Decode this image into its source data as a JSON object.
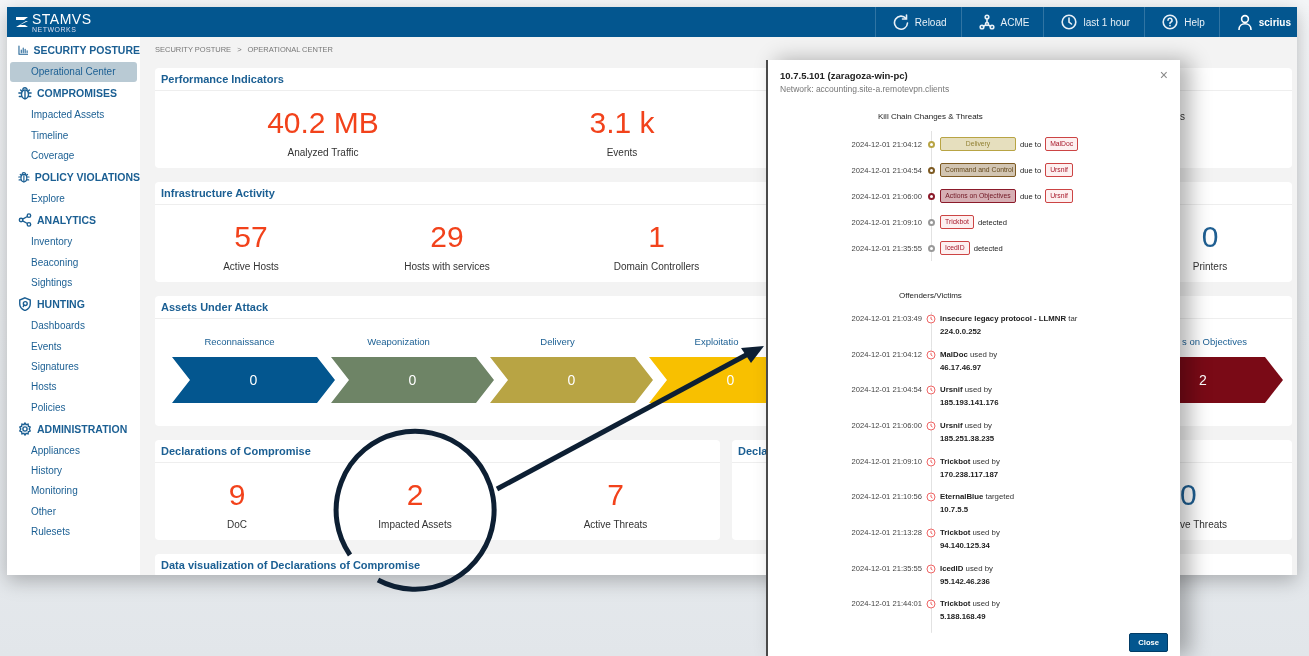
{
  "topbar": {
    "logo": {
      "name": "STAMVS",
      "tagline": "NETWORKS"
    },
    "actions": [
      {
        "kind": "reload",
        "label": "Reload"
      },
      {
        "kind": "tenant",
        "label": "ACME"
      },
      {
        "kind": "time",
        "label": "last 1 hour"
      },
      {
        "kind": "help",
        "label": "Help"
      },
      {
        "kind": "user",
        "label": "scirius"
      }
    ]
  },
  "sidebar": {
    "sections": [
      {
        "kind": "posture",
        "title": "SECURITY POSTURE",
        "items": [
          {
            "label": "Operational Center",
            "selected": true
          }
        ]
      },
      {
        "kind": "compromises",
        "title": "COMPROMISES",
        "items": [
          {
            "label": "Impacted Assets",
            "selected": false
          },
          {
            "label": "Timeline",
            "selected": false
          },
          {
            "label": "Coverage",
            "selected": false
          }
        ]
      },
      {
        "kind": "policy",
        "title": "POLICY VIOLATIONS",
        "items": [
          {
            "label": "Explore",
            "selected": false
          }
        ]
      },
      {
        "kind": "analytics",
        "title": "ANALYTICS",
        "items": [
          {
            "label": "Inventory",
            "selected": false
          },
          {
            "label": "Beaconing",
            "selected": false
          },
          {
            "label": "Sightings",
            "selected": false
          }
        ]
      },
      {
        "kind": "hunting",
        "title": "HUNTING",
        "items": [
          {
            "label": "Dashboards",
            "selected": false
          },
          {
            "label": "Events",
            "selected": false
          },
          {
            "label": "Signatures",
            "selected": false
          },
          {
            "label": "Hosts",
            "selected": false
          },
          {
            "label": "Policies",
            "selected": false
          }
        ]
      },
      {
        "kind": "admin",
        "title": "ADMINISTRATION",
        "items": [
          {
            "label": "Appliances",
            "selected": false
          },
          {
            "label": "History",
            "selected": false
          },
          {
            "label": "Monitoring",
            "selected": false
          },
          {
            "label": "Other",
            "selected": false
          },
          {
            "label": "Rulesets",
            "selected": false
          }
        ]
      }
    ]
  },
  "breadcrumb": {
    "items": [
      "SECURITY POSTURE",
      "OPERATIONAL CENTER"
    ],
    "separator": ">"
  },
  "rows": [
    {
      "cards": [
        {
          "kind": "stats",
          "title": "Performance Indicators",
          "stats": [
            {
              "value": "40.2 MB",
              "label": "Analyzed Traffic",
              "alert": true
            },
            {
              "value": "3.1 k",
              "label": "Events",
              "alert": true
            }
          ],
          "right_stats": [
            {
              "label": "s"
            }
          ]
        }
      ]
    },
    {
      "cards": [
        {
          "kind": "stats",
          "title": "Infrastructure Activity",
          "stats": [
            {
              "value": "57",
              "label": "Active Hosts",
              "alert": true
            },
            {
              "value": "29",
              "label": "Hosts with services",
              "alert": true
            },
            {
              "value": "1",
              "label": "Domain Controllers",
              "alert": true
            }
          ],
          "right_stats": [
            {
              "value": "0",
              "label": "Printers",
              "alert": false
            }
          ]
        }
      ]
    },
    {
      "cards": [
        {
          "kind": "chain",
          "title": "Assets Under Attack",
          "stages": [
            {
              "label": "Reconnaissance",
              "value": "0",
              "color": "#03568f"
            },
            {
              "label": "Weaponization",
              "value": "0",
              "color": "#6e8466"
            },
            {
              "label": "Delivery",
              "value": "0",
              "color": "#b8a444"
            },
            {
              "label": "Exploitatio",
              "value": "0",
              "color": "#f8c000"
            }
          ],
          "right_stage": {
            "label": "s on Objectives",
            "value": "2",
            "color": "#7a0a16"
          }
        }
      ]
    },
    {
      "cards": [
        {
          "kind": "stats",
          "title": "Declarations of Compromise",
          "stats": [
            {
              "value": "9",
              "label": "DoC",
              "alert": true
            },
            {
              "value": "2",
              "label": "Impacted Assets",
              "alert": true
            },
            {
              "value": "7",
              "label": "Active Threats",
              "alert": true
            }
          ]
        },
        {
          "kind": "stats",
          "title": "Decla",
          "right_stats": [
            {
              "value": "0",
              "label": "ve Threats",
              "alert": false
            }
          ]
        }
      ]
    },
    {
      "cards": [
        {
          "kind": "heading",
          "title": "Data visualization of Declarations of Compromise"
        }
      ]
    }
  ],
  "dialog": {
    "title": "10.7.5.101 (zaragoza-win-pc)",
    "subtitle": "Network: accounting.site-a.remotevpn.clients",
    "close_icon": "×",
    "kill_chain": {
      "heading": "Kill Chain Changes & Threats",
      "rows": [
        {
          "kind": "phase_change",
          "time": "2024-12-01 21:04:12",
          "color": "#b8a444",
          "phase": "Delivery",
          "connector": "due to",
          "threat": "MalDoc"
        },
        {
          "kind": "phase_change",
          "time": "2024-12-01 21:04:54",
          "color": "#7d5a22",
          "phase": "Command and Control",
          "connector": "due to",
          "threat": "Ursnif"
        },
        {
          "kind": "phase_change",
          "time": "2024-12-01 21:06:00",
          "color": "#8b1a2a",
          "phase": "Actions on Objectives",
          "connector": "due to",
          "threat": "Ursnif"
        },
        {
          "kind": "detection",
          "time": "2024-12-01 21:09:10",
          "color": "#999999",
          "threat": "Trickbot",
          "connector": "detected"
        },
        {
          "kind": "detection",
          "time": "2024-12-01 21:35:55",
          "color": "#999999",
          "threat": "IcedID",
          "connector": "detected"
        }
      ]
    },
    "offenders": {
      "heading": "Offenders/Victims",
      "rows": [
        {
          "time": "2024-12-01 21:03:49",
          "event": "**Insecure legacy protocol - LLMNR** tar",
          "target": "224.0.0.252"
        },
        {
          "time": "2024-12-01 21:04:12",
          "event": "**MalDoc** used by",
          "target": "46.17.46.97"
        },
        {
          "time": "2024-12-01 21:04:54",
          "event": "**Ursnif** used by",
          "target": "185.193.141.176"
        },
        {
          "time": "2024-12-01 21:06:00",
          "event": "**Ursnif** used by",
          "target": "185.251.38.235"
        },
        {
          "time": "2024-12-01 21:09:10",
          "event": "**Trickbot** used by",
          "target": "170.238.117.187"
        },
        {
          "time": "2024-12-01 21:10:56",
          "event": "**EternalBlue** targeted",
          "target": "10.7.5.5"
        },
        {
          "time": "2024-12-01 21:13:28",
          "event": "**Trickbot** used by",
          "target": "94.140.125.34"
        },
        {
          "time": "2024-12-01 21:35:55",
          "event": "**IcedID** used by",
          "target": "95.142.46.236"
        },
        {
          "time": "2024-12-01 21:44:01",
          "event": "**Trickbot** used by",
          "target": "5.188.168.49"
        }
      ]
    },
    "close_label": "Close"
  }
}
